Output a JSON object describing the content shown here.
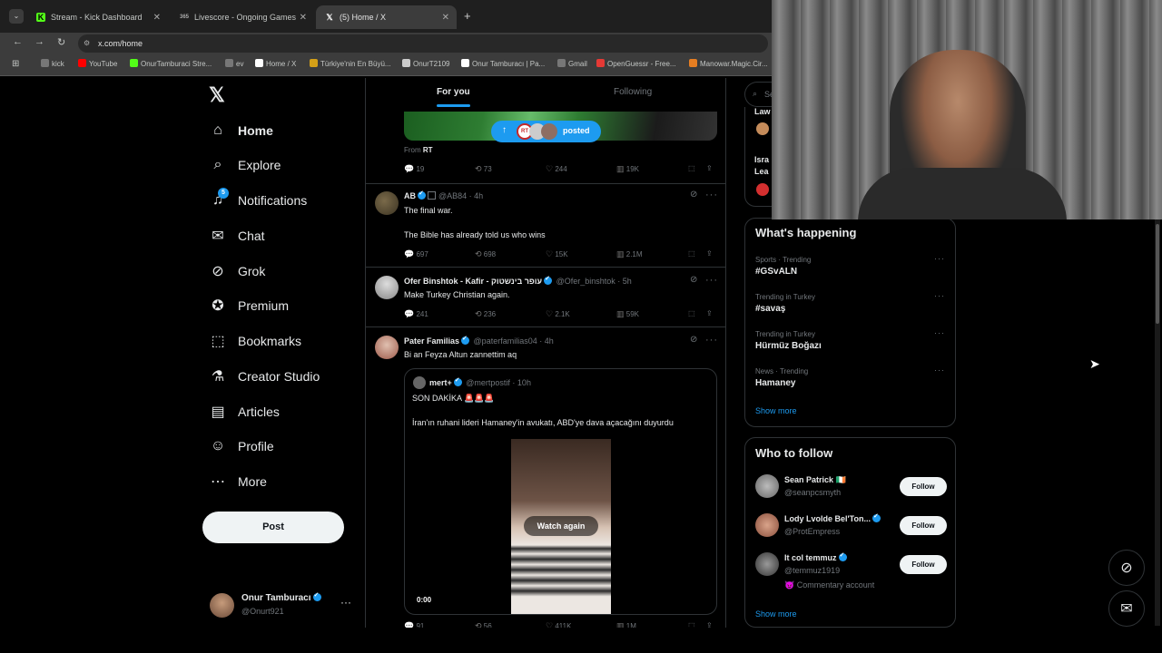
{
  "browser": {
    "tabs": [
      {
        "label": "Stream - Kick Dashboard",
        "fav": "K",
        "favcolor": "#53fc18"
      },
      {
        "label": "Livescore - Ongoing Games an",
        "fav": "365",
        "favcolor": "#aaa"
      },
      {
        "label": "(5) Home / X",
        "fav": "X",
        "favcolor": "#fff"
      }
    ],
    "new_tab": "+",
    "url": "x.com/home",
    "bookmarks": [
      {
        "label": "kick",
        "color": "#777"
      },
      {
        "label": "YouTube",
        "color": "#ff0000"
      },
      {
        "label": "OnurTamburaci Stre...",
        "color": "#53fc18"
      },
      {
        "label": "ev",
        "color": "#777"
      },
      {
        "label": "Home / X",
        "color": "#fff"
      },
      {
        "label": "Türkiye'nin En Büyü...",
        "color": "#d4a017"
      },
      {
        "label": "OnurT2109",
        "color": "#ccc"
      },
      {
        "label": "Onur Tamburacı | Pa...",
        "color": "#fff"
      },
      {
        "label": "Gmail",
        "color": "#777"
      },
      {
        "label": "OpenGuessr - Free...",
        "color": "#e53935"
      },
      {
        "label": "Manowar.Magic.Cir...",
        "color": "#e67e22"
      }
    ]
  },
  "nav": {
    "items": [
      {
        "label": "Home",
        "icon": "home-icon"
      },
      {
        "label": "Explore",
        "icon": "search-icon"
      },
      {
        "label": "Notifications",
        "icon": "bell-icon",
        "badge": "5"
      },
      {
        "label": "Chat",
        "icon": "mail-icon"
      },
      {
        "label": "Grok",
        "icon": "grok-icon"
      },
      {
        "label": "Premium",
        "icon": "premium-icon"
      },
      {
        "label": "Bookmarks",
        "icon": "bookmark-icon"
      },
      {
        "label": "Creator Studio",
        "icon": "flask-icon"
      },
      {
        "label": "Articles",
        "icon": "article-icon"
      },
      {
        "label": "Profile",
        "icon": "person-icon"
      },
      {
        "label": "More",
        "icon": "more-circle-icon"
      }
    ],
    "post": "Post",
    "account": {
      "name": "Onur Tamburacı",
      "handle": "@Onurt921"
    }
  },
  "feed": {
    "tabs": [
      "For you",
      "Following"
    ],
    "posted_pill": "posted",
    "tweets": [
      {
        "from_label": "From",
        "from_source": "RT",
        "stats": {
          "reply": "19",
          "repost": "73",
          "like": "244",
          "views": "19K"
        }
      },
      {
        "name": "AB",
        "handle": "@AB84 · 4h",
        "text1": "The final war.",
        "text2": "The Bible has already told us who wins",
        "stats": {
          "reply": "697",
          "repost": "698",
          "like": "15K",
          "views": "2.1M"
        }
      },
      {
        "name": "Ofer Binshtok - Kafir - עופר בינשטוק",
        "handle": "@Ofer_binshtok · 5h",
        "text1": "Make Turkey Christian again.",
        "stats": {
          "reply": "241",
          "repost": "236",
          "like": "2.1K",
          "views": "59K"
        }
      },
      {
        "name": "Pater Familias",
        "handle": "@paterfamilias04 · 4h",
        "text1": "Bi an Feyza Altun zannettim aq",
        "quote": {
          "name": "mert+",
          "handle": "@mertpostif · 10h",
          "text1": "SON DAKİKA 🚨🚨🚨",
          "text2": "İran'ın ruhani lideri Hamaney'in avukatı, ABD'ye dava açacağını duyurdu",
          "watch_again": "Watch again",
          "time": "0:00"
        },
        "stats": {
          "reply": "91",
          "repost": "56",
          "like": "411K",
          "views": "1M"
        }
      }
    ]
  },
  "right": {
    "search_placeholder": "Search",
    "top_items": [
      "Law",
      "Isra",
      "Lea"
    ],
    "happening": {
      "title": "What's happening",
      "trends": [
        {
          "meta": "Sports · Trending",
          "name": "#GSvALN"
        },
        {
          "meta": "Trending in Turkey",
          "name": "#savaş"
        },
        {
          "meta": "Trending in Turkey",
          "name": "Hürmüz Boğazı"
        },
        {
          "meta": "News · Trending",
          "name": "Hamaney"
        }
      ],
      "show_more": "Show more"
    },
    "who_to_follow": {
      "title": "Who to follow",
      "users": [
        {
          "name": "Sean Patrick 🇮🇪",
          "handle": "@seanpcsmyth",
          "follow": "Follow"
        },
        {
          "name": "Lody Lvolde Bel'Ton...",
          "handle": "@ProtEmpress",
          "follow": "Follow"
        },
        {
          "name": "It col temmuz",
          "handle": "@temmuz1919",
          "extra": "😈 Commentary account",
          "follow": "Follow"
        }
      ],
      "show_more": "Show more"
    }
  }
}
